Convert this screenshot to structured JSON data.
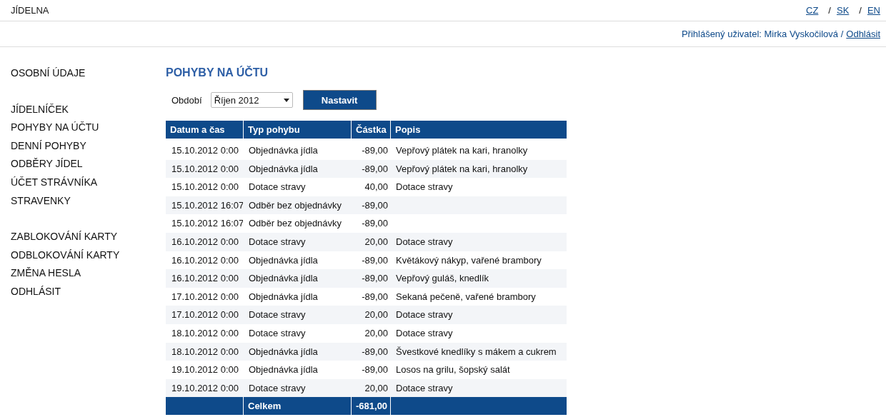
{
  "site_title": "JÍDELNA",
  "languages": [
    {
      "label": "CZ"
    },
    {
      "separator": "/",
      "label": "SK"
    },
    {
      "separator": "/",
      "label": "EN"
    }
  ],
  "user_line": {
    "text": "Přihlášený uživatel: Mirka Vyskočilová /",
    "logout": "Odhlásit"
  },
  "sidebar": {
    "groups": [
      [
        "OSOBNÍ ÚDAJE"
      ],
      [
        "JÍDELNÍČEK",
        "POHYBY NA ÚČTU",
        "DENNÍ POHYBY",
        "ODBĚRY JÍDEL",
        "ÚČET STRÁVNÍKA",
        "STRAVENKY"
      ],
      [
        "ZABLOKOVÁNÍ KARTY",
        "ODBLOKOVÁNÍ KARTY",
        "ZMĚNA HESLA",
        "ODHLÁSIT"
      ]
    ]
  },
  "page_title": "POHYBY NA ÚČTU",
  "filter": {
    "label": "Období",
    "value": "Říjen 2012",
    "button": "Nastavit"
  },
  "table": {
    "columns": [
      "Datum a čas",
      "Typ pohybu",
      "Částka",
      "Popis"
    ],
    "rows": [
      [
        "15.10.2012 0:00",
        "Objednávka jídla",
        "-89,00",
        "Vepřový plátek na kari, hranolky"
      ],
      [
        "15.10.2012 0:00",
        "Objednávka jídla",
        "-89,00",
        "Vepřový plátek na kari, hranolky"
      ],
      [
        "15.10.2012 0:00",
        "Dotace stravy",
        "40,00",
        "Dotace stravy"
      ],
      [
        "15.10.2012 16:07",
        "Odběr bez objednávky",
        "-89,00",
        ""
      ],
      [
        "15.10.2012 16:07",
        "Odběr bez objednávky",
        "-89,00",
        ""
      ],
      [
        "16.10.2012 0:00",
        "Dotace stravy",
        "20,00",
        "Dotace stravy"
      ],
      [
        "16.10.2012 0:00",
        "Objednávka jídla",
        "-89,00",
        "Květákový nákyp, vařené brambory"
      ],
      [
        "16.10.2012 0:00",
        "Objednávka jídla",
        "-89,00",
        "Vepřový guláš, knedlík"
      ],
      [
        "17.10.2012 0:00",
        "Objednávka jídla",
        "-89,00",
        "Sekaná pečeně, vařené brambory"
      ],
      [
        "17.10.2012 0:00",
        "Dotace stravy",
        "20,00",
        "Dotace stravy"
      ],
      [
        "18.10.2012 0:00",
        "Dotace stravy",
        "20,00",
        "Dotace stravy"
      ],
      [
        "18.10.2012 0:00",
        "Objednávka jídla",
        "-89,00",
        "Švestkové knedlíky s mákem a cukrem"
      ],
      [
        "19.10.2012 0:00",
        "Objednávka jídla",
        "-89,00",
        "Losos na grilu, šopský salát"
      ],
      [
        "19.10.2012 0:00",
        "Dotace stravy",
        "20,00",
        "Dotace stravy"
      ]
    ],
    "total": {
      "label": "Celkem",
      "amount": "-681,00"
    }
  }
}
